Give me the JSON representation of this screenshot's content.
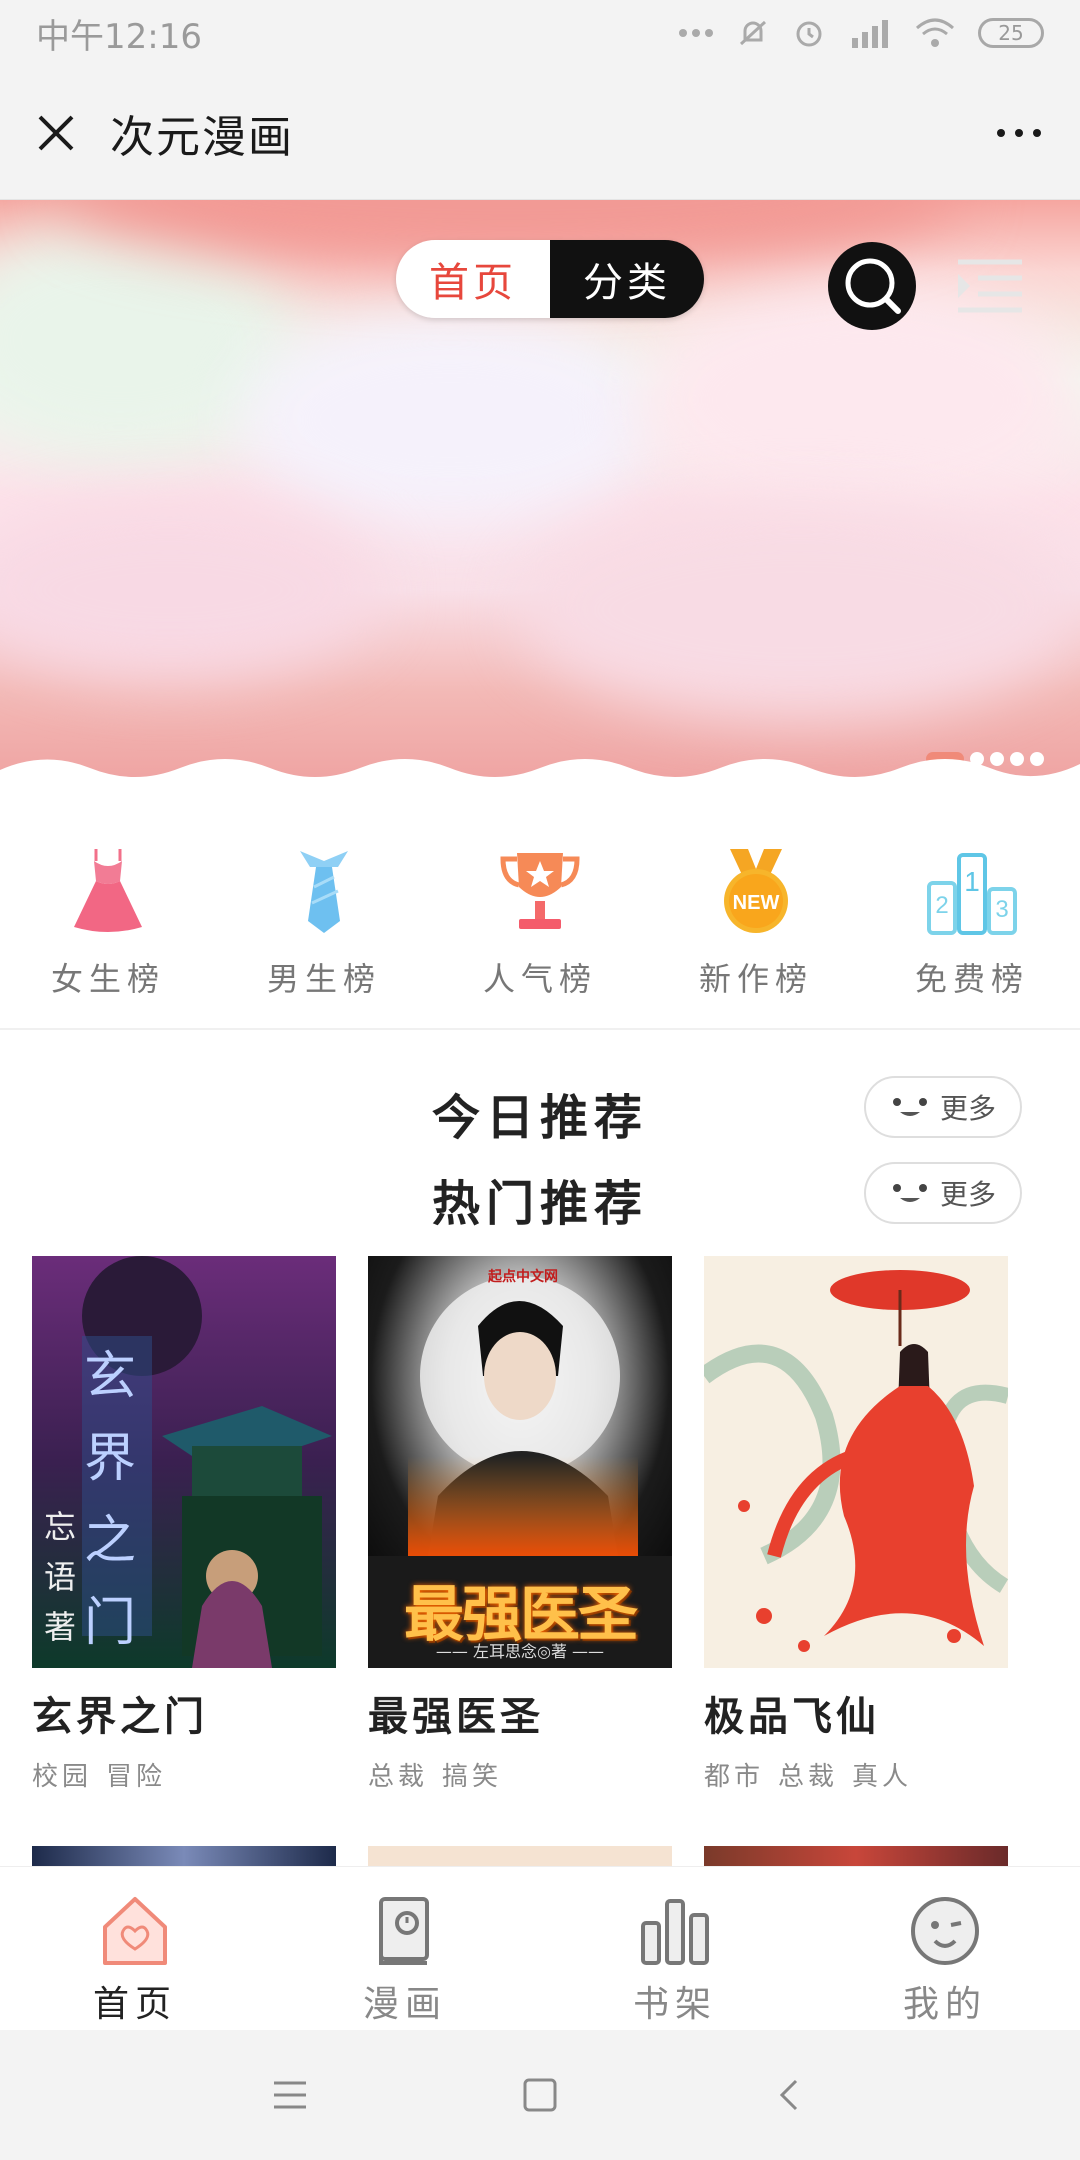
{
  "status_bar": {
    "time": "中午12:16",
    "battery": "25"
  },
  "title_bar": {
    "title": "次元漫画"
  },
  "banner": {
    "tabs": {
      "home": "首页",
      "category": "分类"
    },
    "active_tab": "分类",
    "slide_count": 5,
    "active_slide": 1
  },
  "ranks": [
    {
      "label": "女生榜",
      "icon": "dress-icon"
    },
    {
      "label": "男生榜",
      "icon": "necktie-icon"
    },
    {
      "label": "人气榜",
      "icon": "trophy-icon"
    },
    {
      "label": "新作榜",
      "icon": "new-medal-icon",
      "badge": "NEW"
    },
    {
      "label": "免费榜",
      "icon": "podium-icon",
      "podium": [
        "2",
        "1",
        "3"
      ]
    }
  ],
  "sections": {
    "today": {
      "title": "今日推荐",
      "more": "更多"
    },
    "hot": {
      "title": "热门推荐",
      "more": "更多"
    }
  },
  "books": [
    {
      "title": "玄界之门",
      "tags": [
        "校园",
        "冒险"
      ],
      "cover_text": "玄界之门",
      "cover_author": "忘语 著"
    },
    {
      "title": "最强医圣",
      "tags": [
        "总裁",
        "搞笑"
      ],
      "cover_text": "最强医圣",
      "cover_author": "—— 左耳思念◎著 ——",
      "cover_publisher": "起点中文网"
    },
    {
      "title": "极品飞仙",
      "tags": [
        "都市",
        "总裁",
        "真人"
      ]
    }
  ],
  "bottom_nav": [
    {
      "label": "首页",
      "icon": "home-heart-icon",
      "active": true
    },
    {
      "label": "漫画",
      "icon": "book-icon",
      "active": false
    },
    {
      "label": "书架",
      "icon": "bookshelf-icon",
      "active": false
    },
    {
      "label": "我的",
      "icon": "face-icon",
      "active": false
    }
  ],
  "colors": {
    "accent": "#e7473c",
    "pink": "#f08a79",
    "gray_text": "#888888"
  }
}
